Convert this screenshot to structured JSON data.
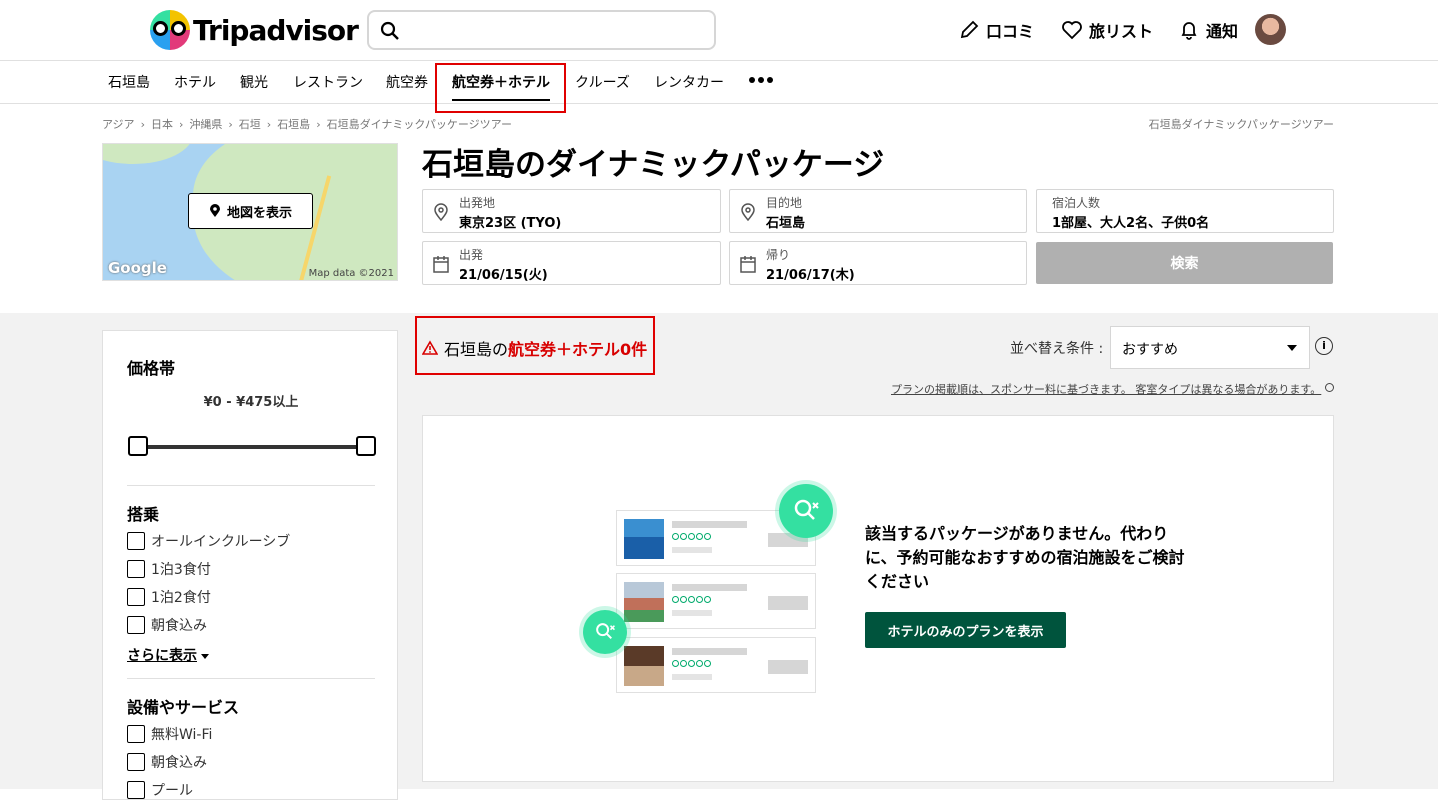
{
  "brand": {
    "name": "Tripadvisor"
  },
  "search": {
    "placeholder": ""
  },
  "topnav": {
    "reviews": "口コミ",
    "trips": "旅リスト",
    "alerts": "通知"
  },
  "categories": [
    "石垣島",
    "ホテル",
    "観光",
    "レストラン",
    "航空券",
    "航空券＋ホテル",
    "クルーズ",
    "レンタカー"
  ],
  "active_category": "航空券＋ホテル",
  "breadcrumbs": [
    "アジア",
    "日本",
    "沖縄県",
    "石垣",
    "石垣島",
    "石垣島ダイナミックパッケージツアー"
  ],
  "breadcrumb_right": "石垣島ダイナミックパッケージツアー",
  "map": {
    "button_label": "地図を表示",
    "logo": "Google",
    "copyright": "Map data ©2021"
  },
  "page_title": "石垣島のダイナミックパッケージ",
  "form": {
    "origin": {
      "label": "出発地",
      "value": "東京23区 (TYO)"
    },
    "destination": {
      "label": "目的地",
      "value": "石垣島"
    },
    "guests": {
      "label": "宿泊人数",
      "value": "1部屋、大人2名、子供0名"
    },
    "depart": {
      "label": "出発",
      "value": "21/06/15(火)"
    },
    "return": {
      "label": "帰り",
      "value": "21/06/17(木)"
    },
    "search_button": "検索"
  },
  "filters": {
    "price": {
      "title": "価格帯",
      "range": "¥0 - ¥475以上"
    },
    "board": {
      "title": "搭乗",
      "options": [
        "オールインクルーシブ",
        "1泊3食付",
        "1泊2食付",
        "朝食込み"
      ],
      "show_more": "さらに表示"
    },
    "amenities": {
      "title": "設備やサービス",
      "options": [
        "無料Wi-Fi",
        "朝食込み",
        "プール"
      ]
    }
  },
  "results": {
    "prefix": "石垣島の",
    "highlight": "航空券＋ホテル0件",
    "sort_label": "並べ替え条件 :",
    "sort_value": "おすすめ",
    "sponsor_note": "プランの掲載順は、スポンサー料に基づきます。 客室タイプは異なる場合があります。",
    "empty_message": "該当するパッケージがありません。代わりに、予約可能なおすすめの宿泊施設をご検討ください",
    "hotel_button": "ホテルのみのプランを表示"
  },
  "colors": {
    "accent_green": "#34e0a1",
    "button_dark_green": "#00543d",
    "highlight_red": "#d80000"
  }
}
